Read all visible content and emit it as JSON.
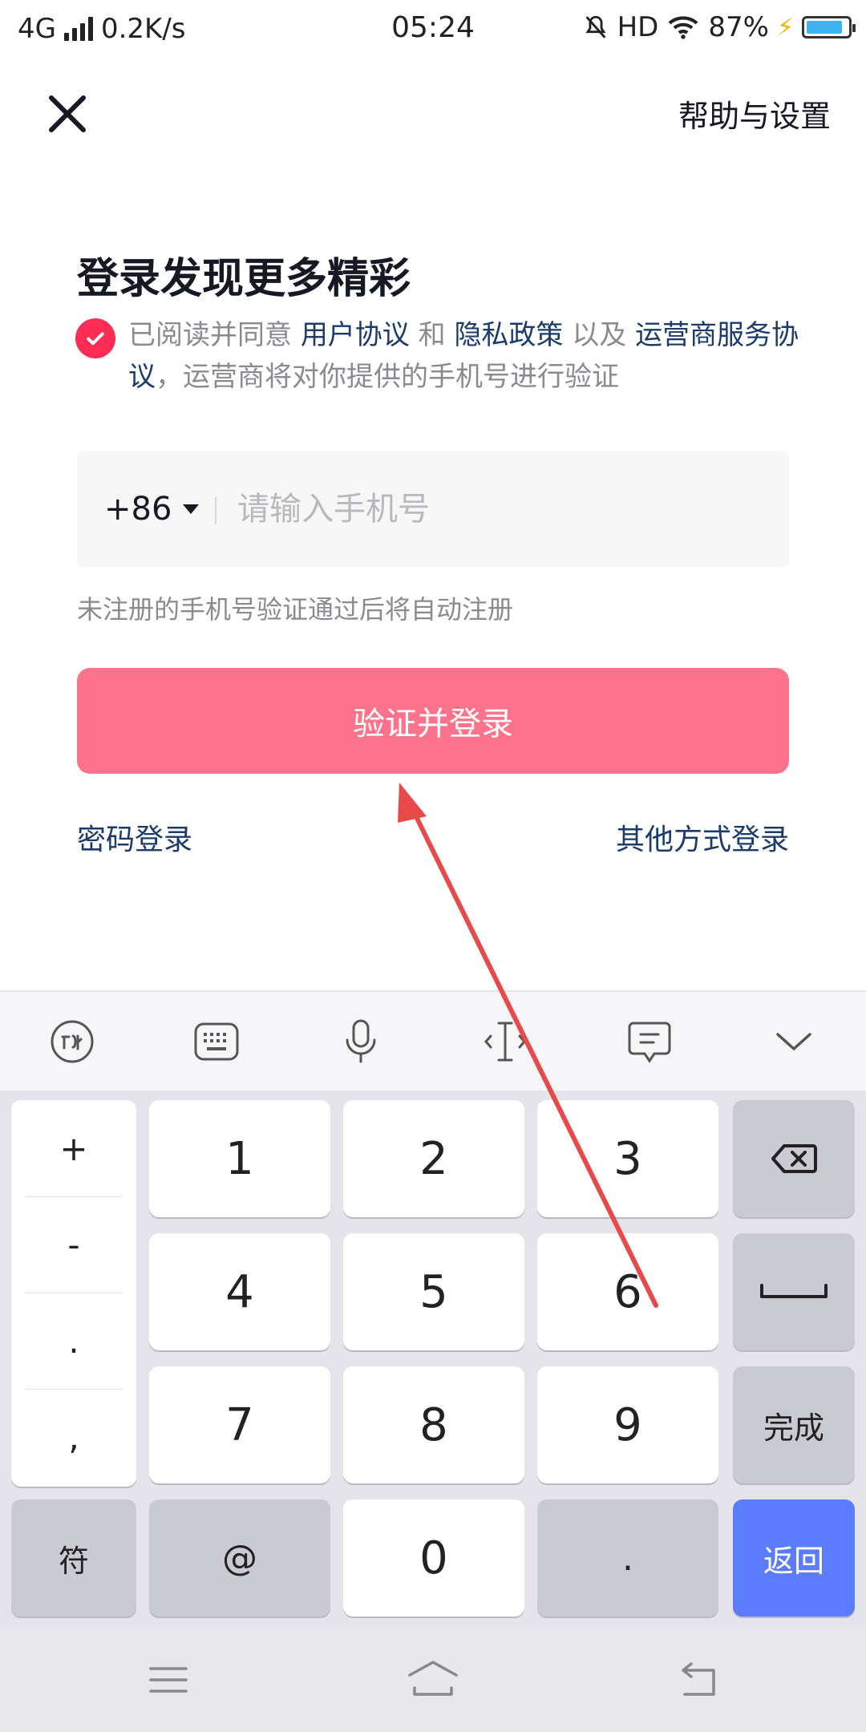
{
  "status_bar": {
    "network": "4G",
    "speed": "0.2K/s",
    "time": "05:24",
    "hd": "HD",
    "battery": "87%",
    "battery_level": 0.87
  },
  "header": {
    "close_icon": "close-icon",
    "help_label": "帮助与设置"
  },
  "main": {
    "title": "登录发现更多精彩",
    "agreement": {
      "checked": true,
      "prefix": "已阅读并同意 ",
      "user_agreement": "用户协议",
      "and": " 和 ",
      "privacy_policy": "隐私政策",
      "as_well_as": " 以及 ",
      "carrier_agreement": "运营商服务协议",
      "suffix": "，运营商将对你提供的手机号进行验证"
    },
    "country_code": "+86",
    "phone_placeholder": "请输入手机号",
    "hint": "未注册的手机号验证通过后将自动注册",
    "login_button": "验证并登录",
    "password_login": "密码登录",
    "other_login": "其他方式登录"
  },
  "keyboard": {
    "toolbar": [
      "xunfei-icon",
      "keyboard-icon",
      "microphone-icon",
      "cursor-icon",
      "clipboard-icon",
      "collapse-chevron-icon"
    ],
    "symbols": [
      "+",
      "-",
      ".",
      ","
    ],
    "digits": [
      "1",
      "2",
      "3",
      "4",
      "5",
      "6",
      "7",
      "8",
      "9",
      "0"
    ],
    "backspace": "backspace-icon",
    "space": "space-icon",
    "done": "完成",
    "fu": "符",
    "at": "@",
    "dot": ".",
    "return": "返回",
    "accent": "#5b7cff"
  },
  "nav_bar": [
    "menu-icon",
    "home-icon",
    "back-icon"
  ],
  "colors": {
    "brand": "#fe2c55",
    "button": "#fe738c",
    "link": "#1a3b6b",
    "annotation_arrow": "#e84a4a"
  }
}
